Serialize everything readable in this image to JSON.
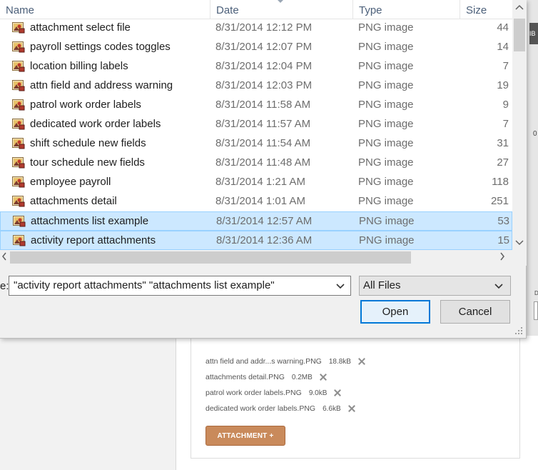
{
  "dialog": {
    "columns": {
      "name": "Name",
      "date": "Date",
      "type": "Type",
      "size": "Size"
    },
    "files": [
      {
        "name": "attachment select file",
        "date": "8/31/2014 12:12 PM",
        "type": "PNG image",
        "size": "44",
        "selected": false
      },
      {
        "name": "payroll settings codes toggles",
        "date": "8/31/2014 12:07 PM",
        "type": "PNG image",
        "size": "14",
        "selected": false
      },
      {
        "name": "location billing labels",
        "date": "8/31/2014 12:04 PM",
        "type": "PNG image",
        "size": "7",
        "selected": false
      },
      {
        "name": "attn field and address warning",
        "date": "8/31/2014 12:03 PM",
        "type": "PNG image",
        "size": "19",
        "selected": false
      },
      {
        "name": "patrol work order labels",
        "date": "8/31/2014 11:58 AM",
        "type": "PNG image",
        "size": "9",
        "selected": false
      },
      {
        "name": "dedicated work order labels",
        "date": "8/31/2014 11:57 AM",
        "type": "PNG image",
        "size": "7",
        "selected": false
      },
      {
        "name": "shift schedule new fields",
        "date": "8/31/2014 11:54 AM",
        "type": "PNG image",
        "size": "31",
        "selected": false
      },
      {
        "name": "tour schedule new fields",
        "date": "8/31/2014 11:48 AM",
        "type": "PNG image",
        "size": "27",
        "selected": false
      },
      {
        "name": "employee payroll",
        "date": "8/31/2014 1:21 AM",
        "type": "PNG image",
        "size": "118",
        "selected": false
      },
      {
        "name": "attachments detail",
        "date": "8/31/2014 1:01 AM",
        "type": "PNG image",
        "size": "251",
        "selected": false
      },
      {
        "name": "attachments list example",
        "date": "8/31/2014 12:57 AM",
        "type": "PNG image",
        "size": "53",
        "selected": true
      },
      {
        "name": "activity report attachments",
        "date": "8/31/2014 12:36 AM",
        "type": "PNG image",
        "size": "15",
        "selected": true
      }
    ],
    "filename_label": "e:",
    "filename_value": "\"activity report attachments\" \"attachments list example\"",
    "filter_value": "All Files",
    "open_label": "Open",
    "cancel_label": "Cancel",
    "icons": {
      "file": "png-image-file-icon",
      "scroll_up": "chevron-up-icon",
      "scroll_down": "chevron-down-icon",
      "scroll_left": "chevron-left-icon",
      "scroll_right": "chevron-right-icon",
      "dropdown": "chevron-down-icon",
      "resize": "resize-grip-icon"
    }
  },
  "background": {
    "attachments": [
      {
        "name": "attn field and addr...s warning.PNG",
        "size": "18.8kB"
      },
      {
        "name": "attachments detail.PNG",
        "size": "0.2MB"
      },
      {
        "name": "patrol work order labels.PNG",
        "size": "9.0kB"
      },
      {
        "name": "dedicated work order labels.PNG",
        "size": "6.6kB"
      }
    ],
    "attach_button": "ATTACHMENT +",
    "right_edge_texts": [
      "IB",
      "0",
      "D"
    ],
    "accent": "#c98a5b"
  },
  "colors": {
    "selection_bg": "#cce8ff",
    "selection_border": "#99d1ff",
    "header_text": "#4c607a",
    "primary_border": "#0078d7"
  }
}
